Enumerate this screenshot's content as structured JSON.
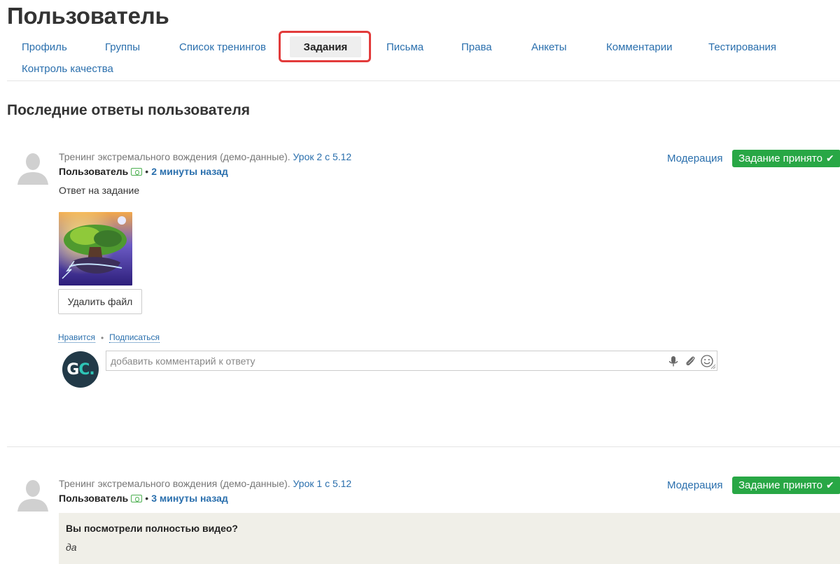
{
  "page": {
    "title": "Пользователь",
    "section_title": "Последние ответы пользователя"
  },
  "tabs": {
    "items": [
      {
        "label": "Профиль",
        "active": false
      },
      {
        "label": "Группы",
        "active": false
      },
      {
        "label": "Список тренингов",
        "active": false
      },
      {
        "label": "Задания",
        "active": true
      },
      {
        "label": "Письма",
        "active": false
      },
      {
        "label": "Права",
        "active": false
      },
      {
        "label": "Анкеты",
        "active": false
      },
      {
        "label": "Комментарии",
        "active": false
      },
      {
        "label": "Тестирования",
        "active": false
      },
      {
        "label": "Контроль качества",
        "active": false
      }
    ],
    "highlight_color": "#e23b3b"
  },
  "answers": [
    {
      "training": "Тренинг экстремального вождения (демо-данные).",
      "lesson": "Урок 2 с 5.12",
      "author": "Пользователь",
      "time": "2 минуты назад",
      "moderation_label": "Модерация",
      "status_label": "Задание принято",
      "text": "Ответ на задание",
      "delete_file_label": "Удалить файл",
      "like_label": "Нравится",
      "subscribe_label": "Подписаться",
      "comment_placeholder": "добавить комментарий к ответу",
      "commenter_avatar": {
        "letter1": "G",
        "letter2": "C",
        "suffix": "."
      }
    },
    {
      "training": "Тренинг экстремального вождения (демо-данные).",
      "lesson": "Урок 1 с 5.12",
      "author": "Пользователь",
      "time": "3 минуты назад",
      "moderation_label": "Модерация",
      "status_label": "Задание принято",
      "question": "Вы посмотрели полностью видео?",
      "question_answer": "да"
    }
  ],
  "colors": {
    "link": "#2a6fad",
    "success": "#28a745",
    "text": "#333333",
    "question_bg": "#f0efe8"
  },
  "icons": {
    "status_check": "check-icon",
    "author_badge": "money-icon",
    "microphone": "microphone-icon",
    "attachment": "paperclip-icon",
    "emoji": "smiley-icon"
  }
}
